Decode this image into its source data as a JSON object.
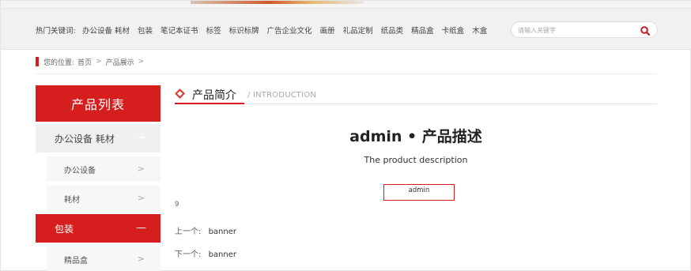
{
  "keywords": {
    "label": "热门关键词:",
    "items": [
      "办公设备 耗材",
      "包装",
      "笔记本证书",
      "标签",
      "标识标牌",
      "广告企业文化",
      "画册",
      "礼品定制",
      "纸品类",
      "精品盒",
      "卡纸盒",
      "木盒"
    ]
  },
  "search": {
    "placeholder": "请输入关键字"
  },
  "breadcrumb": {
    "label": "您的位置:",
    "home": "首页",
    "current": "产品展示",
    "sep": ">"
  },
  "sidebar": {
    "title": "产品列表",
    "categories": [
      {
        "label": "办公设备 耗材",
        "toggle": "+",
        "subs": [
          "办公设备",
          "耗材"
        ]
      },
      {
        "label": "包装",
        "toggle": "—",
        "subs": [
          "精品盒"
        ]
      }
    ]
  },
  "section": {
    "title": "产品简介",
    "subtitle": "/ INTRODUCTION"
  },
  "product": {
    "title": "admin • 产品描述",
    "description": "The product description",
    "tag": "admin",
    "number": "9",
    "prev_label": "上一个:",
    "prev_value": "banner",
    "next_label": "下一个:",
    "next_value": "banner"
  },
  "colors": {
    "accent": "#d71e1e",
    "sidebar_bg": "#f0f0f0"
  }
}
